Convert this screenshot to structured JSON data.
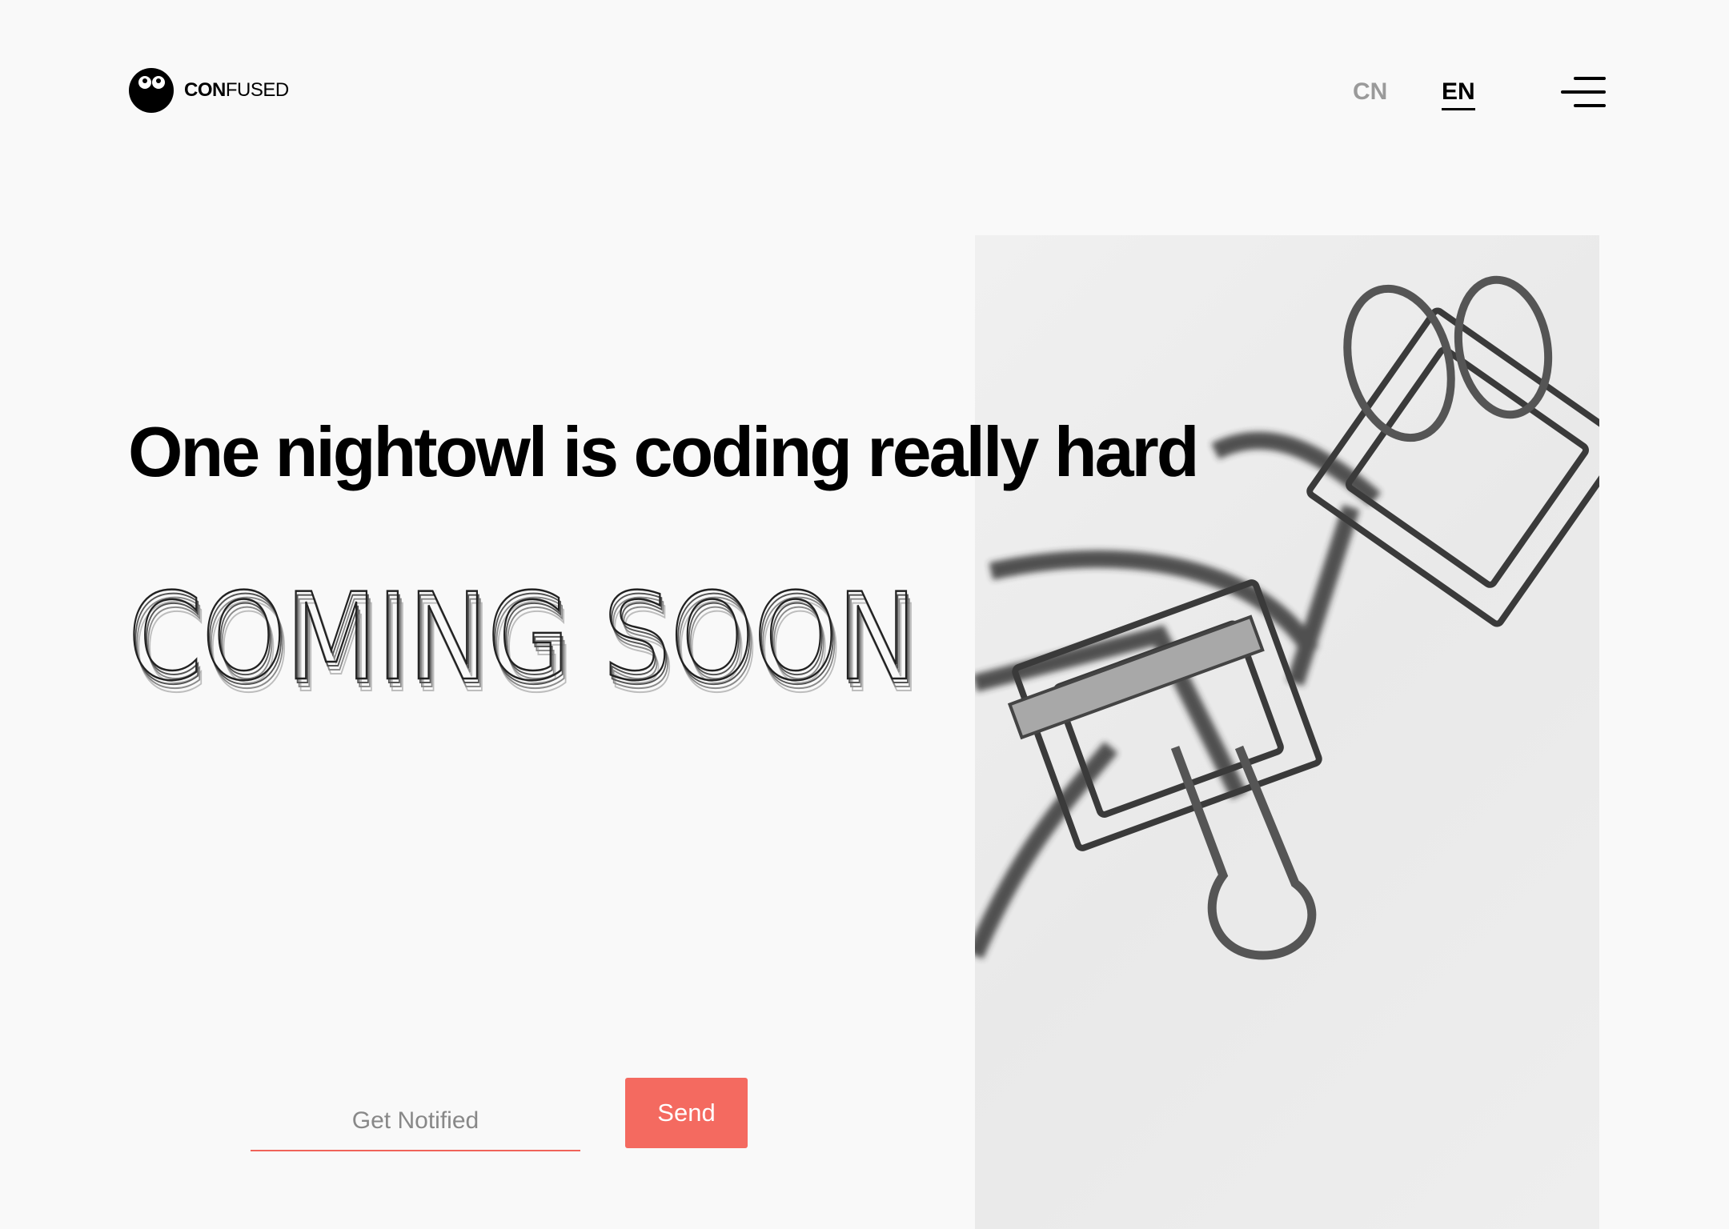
{
  "brand": {
    "bold": "CON",
    "light": "FUSED"
  },
  "header": {
    "languages": [
      {
        "label": "CN",
        "active": false
      },
      {
        "label": "EN",
        "active": true
      }
    ],
    "menu_icon": "hamburger-menu-icon"
  },
  "hero": {
    "headline": "One nightowl is coding really hard",
    "coming_soon": "COMING SOON",
    "image": "binder-clips-photo"
  },
  "signup": {
    "input_value": "",
    "placeholder": "Get Notified",
    "send_label": "Send"
  },
  "colors": {
    "background": "#f9f9f9",
    "accent": "#f46a60",
    "text": "#000000",
    "muted": "#9a9a9a"
  }
}
